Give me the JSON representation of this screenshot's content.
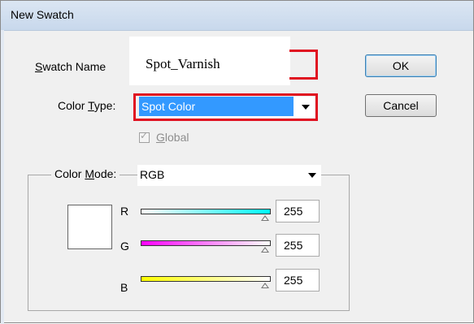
{
  "dialog": {
    "title": "New Swatch",
    "swatch_name": {
      "label_first": "S",
      "label_rest": "watch Name",
      "value": "Spot_Varnish"
    },
    "color_type": {
      "label_pre": "Color ",
      "label_ul": "T",
      "label_post": "ype:",
      "value": "Spot Color"
    },
    "global": {
      "label_ul": "G",
      "label_rest": "lobal",
      "checked": true,
      "enabled": false
    },
    "color_mode": {
      "label_pre": "Color ",
      "label_ul": "M",
      "label_post": "ode:",
      "value": "RGB"
    },
    "channels": [
      {
        "label": "R",
        "value": "255",
        "gradient_start": "#ffffff",
        "gradient_end": "#00ffff"
      },
      {
        "label": "G",
        "value": "255",
        "gradient_start": "#ff00ff",
        "gradient_end": "#ffffff"
      },
      {
        "label": "B",
        "value": "255",
        "gradient_start": "#ffff00",
        "gradient_end": "#ffffff"
      }
    ],
    "preview_color": "#ffffff",
    "buttons": {
      "ok": "OK",
      "cancel": "Cancel"
    },
    "highlight_color": "#e01020"
  }
}
